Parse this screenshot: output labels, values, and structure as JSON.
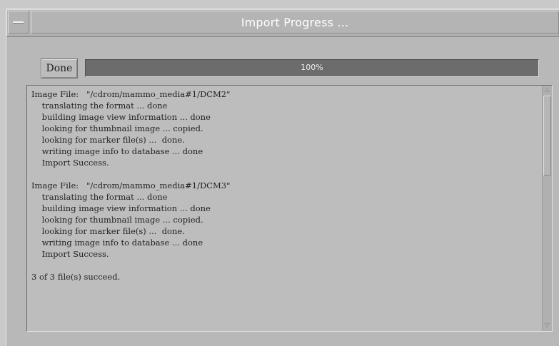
{
  "window": {
    "title": "Import Progress ..."
  },
  "controls": {
    "done_label": "Done"
  },
  "progress": {
    "percent": 100,
    "label": "100%"
  },
  "log": {
    "lines": [
      "Image File:   \"/cdrom/mammo_media#1/DCM2\"",
      "    translating the format ... done",
      "    building image view information ... done",
      "    looking for thumbnail image ... copied.",
      "    looking for marker file(s) ...  done.",
      "    writing image info to database ... done",
      "    Import Success.",
      "",
      "Image File:   \"/cdrom/mammo_media#1/DCM3\"",
      "    translating the format ... done",
      "    building image view information ... done",
      "    looking for thumbnail image ... copied.",
      "    looking for marker file(s) ...  done.",
      "    writing image info to database ... done",
      "    Import Success.",
      "",
      "3 of 3 file(s) succeed."
    ]
  },
  "icons": {
    "window_menu": "window-menu-icon",
    "scroll_up": "scroll-up-arrow-icon",
    "scroll_down": "scroll-down-arrow-icon"
  },
  "colors": {
    "window_bg": "#b8b8b8",
    "progress_fill": "#6c6c6c",
    "title_text": "#ffffff"
  }
}
